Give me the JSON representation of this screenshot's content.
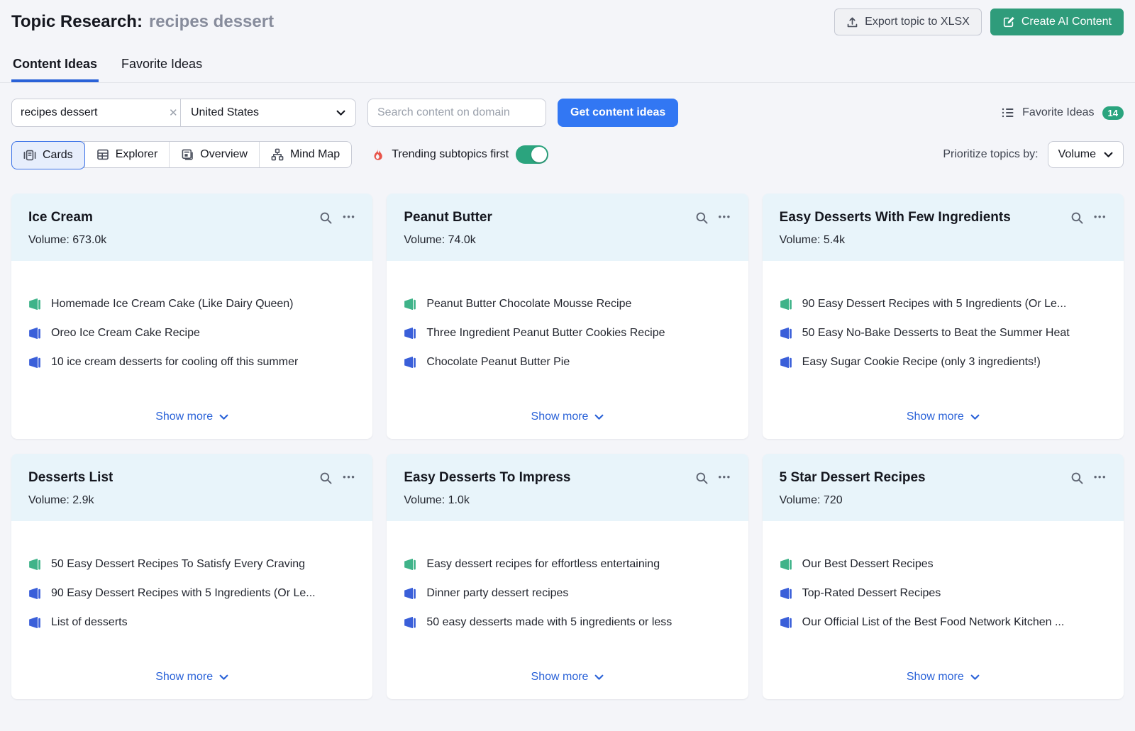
{
  "header": {
    "title": "Topic Research:",
    "query": "recipes dessert",
    "export_label": "Export topic to XLSX",
    "create_ai_label": "Create AI Content"
  },
  "tabs": [
    {
      "label": "Content Ideas",
      "active": true
    },
    {
      "label": "Favorite Ideas",
      "active": false
    }
  ],
  "search": {
    "keyword_value": "recipes dessert",
    "country_value": "United States",
    "domain_placeholder": "Search content on domain",
    "submit_label": "Get content ideas",
    "favorites_label": "Favorite Ideas",
    "favorites_count": "14"
  },
  "controls": {
    "views": [
      {
        "label": "Cards",
        "active": true
      },
      {
        "label": "Explorer",
        "active": false
      },
      {
        "label": "Overview",
        "active": false
      },
      {
        "label": "Mind Map",
        "active": false
      }
    ],
    "trending_label": "Trending subtopics first",
    "trending_on": true,
    "prioritize_label": "Prioritize topics by:",
    "prioritize_value": "Volume"
  },
  "strings": {
    "volume_label": "Volume:",
    "show_more": "Show more"
  },
  "colors": {
    "page_bg": "#f4f5f9",
    "accent_blue": "#3277f3",
    "link_blue": "#2a62d8",
    "tab_underline": "#2a62d8",
    "green_button": "#2f9c7b",
    "badge_green": "#2aa47e",
    "toggle_green": "#2ba47e",
    "flame_red": "#e8544a",
    "card_header_bg": "#e8f4fa",
    "megaphone_green": "#3fb389",
    "megaphone_blue": "#3a5fd9"
  },
  "cards": [
    {
      "title": "Ice Cream",
      "volume": "673.0k",
      "items": [
        {
          "icon": "green",
          "text": "Homemade Ice Cream Cake (Like Dairy Queen)"
        },
        {
          "icon": "blue",
          "text": "Oreo Ice Cream Cake Recipe"
        },
        {
          "icon": "blue",
          "text": "10 ice cream desserts for cooling off this summer"
        }
      ]
    },
    {
      "title": "Peanut Butter",
      "volume": "74.0k",
      "items": [
        {
          "icon": "green",
          "text": "Peanut Butter Chocolate Mousse Recipe"
        },
        {
          "icon": "blue",
          "text": "Three Ingredient Peanut Butter Cookies Recipe"
        },
        {
          "icon": "blue",
          "text": "Chocolate Peanut Butter Pie"
        }
      ]
    },
    {
      "title": "Easy Desserts With Few Ingredients",
      "volume": "5.4k",
      "items": [
        {
          "icon": "green",
          "text": "90 Easy Dessert Recipes with 5 Ingredients (Or Le..."
        },
        {
          "icon": "blue",
          "text": "50 Easy No-Bake Desserts to Beat the Summer Heat"
        },
        {
          "icon": "blue",
          "text": "Easy Sugar Cookie Recipe (only 3 ingredients!)"
        }
      ]
    },
    {
      "title": "Desserts List",
      "volume": "2.9k",
      "items": [
        {
          "icon": "green",
          "text": "50 Easy Dessert Recipes To Satisfy Every Craving"
        },
        {
          "icon": "blue",
          "text": "90 Easy Dessert Recipes with 5 Ingredients (Or Le..."
        },
        {
          "icon": "blue",
          "text": "List of desserts"
        }
      ]
    },
    {
      "title": "Easy Desserts To Impress",
      "volume": "1.0k",
      "items": [
        {
          "icon": "green",
          "text": "Easy dessert recipes for effortless entertaining"
        },
        {
          "icon": "blue",
          "text": "Dinner party dessert recipes"
        },
        {
          "icon": "blue",
          "text": "50 easy desserts made with 5 ingredients or less"
        }
      ]
    },
    {
      "title": "5 Star Dessert Recipes",
      "volume": "720",
      "items": [
        {
          "icon": "green",
          "text": "Our Best Dessert Recipes"
        },
        {
          "icon": "blue",
          "text": "Top-Rated Dessert Recipes"
        },
        {
          "icon": "blue",
          "text": "Our Official List of the Best Food Network Kitchen ..."
        }
      ]
    }
  ]
}
